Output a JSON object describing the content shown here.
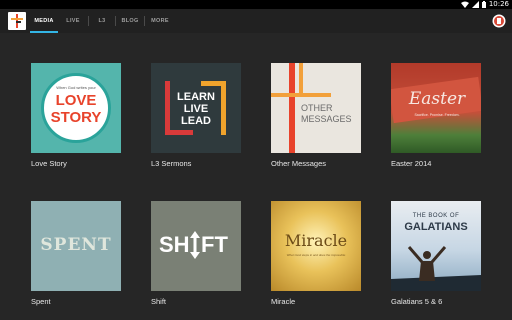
{
  "status": {
    "time": "10:26"
  },
  "tabs": [
    {
      "label": "MEDIA",
      "active": true
    },
    {
      "label": "LIVE",
      "active": false
    },
    {
      "label": "L3",
      "active": false
    },
    {
      "label": "BLOG",
      "active": false
    },
    {
      "label": "MORE",
      "active": false
    }
  ],
  "items": [
    {
      "title": "Love Story",
      "art": {
        "line1": "When God writes your",
        "line2": "LOVE",
        "line3": "STORY"
      }
    },
    {
      "title": "L3 Sermons",
      "art": {
        "line1": "LEARN",
        "line2": "LIVE",
        "line3": "LEAD"
      }
    },
    {
      "title": "Other Messages",
      "art": {
        "line1": "OTHER",
        "line2": "MESSAGES"
      }
    },
    {
      "title": "Easter 2014",
      "art": {
        "line1": "Easter",
        "line2": "Sacrifice. Promise. Freedom."
      }
    },
    {
      "title": "Spent",
      "art": {
        "line1": "SPENT"
      }
    },
    {
      "title": "Shift",
      "art": {
        "line1": "SH",
        "line2": "FT"
      }
    },
    {
      "title": "Miracle",
      "art": {
        "line1": "Miracle",
        "line2": "When God steps in and does the impossible"
      }
    },
    {
      "title": "Galatians 5 & 6",
      "art": {
        "line1": "THE BOOK OF",
        "line2": "GALATIANS"
      }
    }
  ],
  "colors": {
    "accent": "#33b5e5",
    "background": "#262626",
    "actionbar": "#212121"
  },
  "icons": {
    "logo": "church-cross-logo",
    "wifi": "wifi-icon",
    "signal": "signal-icon",
    "battery": "battery-icon",
    "action": "app-action-icon"
  }
}
